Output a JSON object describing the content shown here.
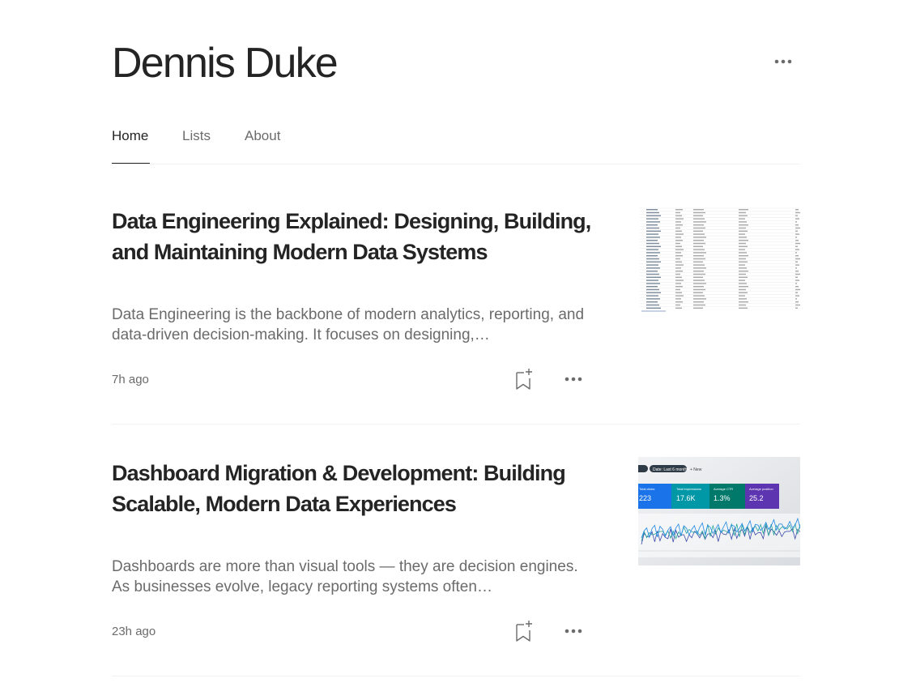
{
  "profile": {
    "name": "Dennis Duke"
  },
  "nav": {
    "tabs": [
      {
        "label": "Home",
        "active": true
      },
      {
        "label": "Lists",
        "active": false
      },
      {
        "label": "About",
        "active": false
      }
    ]
  },
  "articles": [
    {
      "title": "Data Engineering Explained: Designing, Building, and Maintaining Modern Data Systems",
      "excerpt": "Data Engineering is the backbone of modern analytics, reporting, and data-driven decision-making. It focuses on designing,…",
      "time": "7h ago",
      "thumbnail": "spreadsheet-screenshot"
    },
    {
      "title": "Dashboard Migration & Development: Building Scalable, Modern Data Experiences",
      "excerpt": "Dashboards are more than visual tools — they are decision engines. As businesses evolve, legacy reporting systems often…",
      "time": "23h ago",
      "thumbnail": "analytics-dashboard-photo",
      "thumb_chips": [
        "Date: Last 6 months",
        "+ New"
      ],
      "thumb_metrics": [
        {
          "label": "Total clicks",
          "value": "223",
          "color": "#1a73e8"
        },
        {
          "label": "Total impressions",
          "value": "17.6K",
          "color": "#0097a7"
        },
        {
          "label": "Average CTR",
          "value": "1.3%",
          "color": "#00796b"
        },
        {
          "label": "Average position",
          "value": "25.2",
          "color": "#5e35b1"
        }
      ]
    }
  ],
  "colors": {
    "text": "#242424",
    "muted": "#6b6b6b",
    "divider": "#f2f2f2"
  }
}
